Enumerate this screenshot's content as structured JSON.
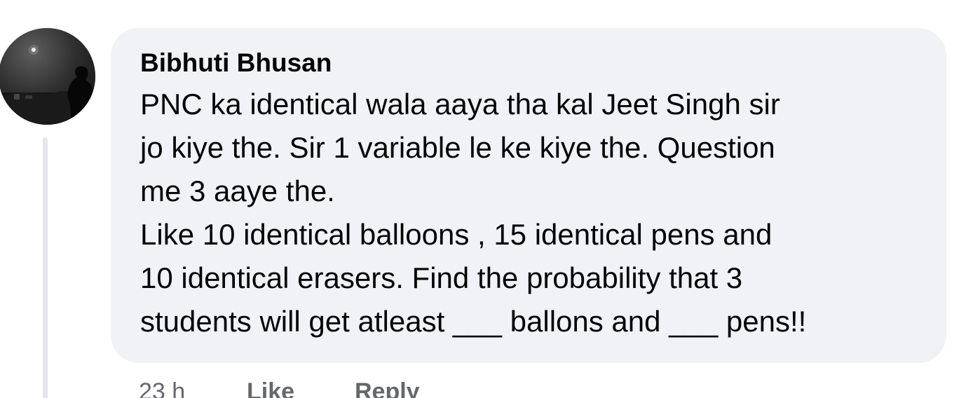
{
  "comment": {
    "author": "Bibhuti Bhusan",
    "lines": [
      "PNC ka identical wala aaya tha kal Jeet Singh sir",
      "jo kiye the. Sir 1 variable le ke kiye the. Question",
      "me 3 aaye the.",
      "Like 10 identical balloons , 15 identical pens and",
      "10 identical erasers. Find the probability that 3",
      "students will get atleast ___ ballons and ___ pens!!"
    ],
    "actions": {
      "time": "23 h",
      "like": "Like",
      "reply": "Reply"
    }
  },
  "colors": {
    "bubble_bg": "#f0f2f5",
    "text": "#050505",
    "secondary_text": "#65676b",
    "thread_line": "#e4e6eb"
  }
}
